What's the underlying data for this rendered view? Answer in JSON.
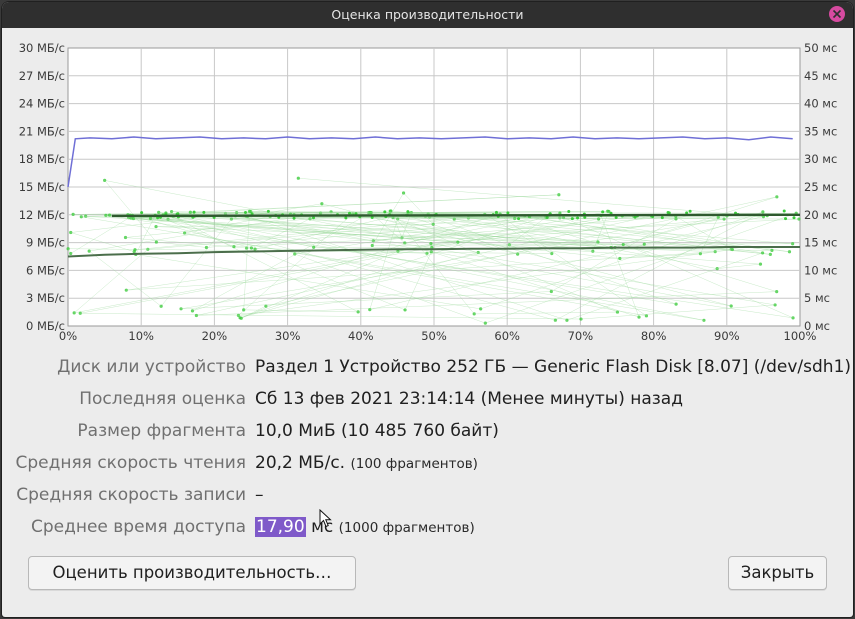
{
  "window": {
    "title": "Оценка производительности"
  },
  "chart": {
    "left_axis_ticks": [
      "30 МБ/с",
      "27 МБ/с",
      "24 МБ/с",
      "21 МБ/с",
      "18 МБ/с",
      "15 МБ/с",
      "12 МБ/с",
      "9 МБ/с",
      "6 МБ/с",
      "3 МБ/с",
      "0 МБ/с"
    ],
    "right_axis_ticks": [
      "50 мс",
      "45 мс",
      "40 мс",
      "35 мс",
      "30 мс",
      "25 мс",
      "20 мс",
      "15 мс",
      "10 мс",
      "5 мс",
      "0 мс"
    ],
    "x_axis_ticks": [
      "0%",
      "10%",
      "20%",
      "30%",
      "40%",
      "50%",
      "60%",
      "70%",
      "80%",
      "90%",
      "100%"
    ],
    "colors": {
      "read_rate": "#6f6fd6",
      "access_time": "#3ccc3c",
      "grid": "#c8c8c8",
      "plot_bg": "#ffffff"
    }
  },
  "chart_data": {
    "type": "line",
    "y_left_range": [
      0,
      30
    ],
    "y_right_range": [
      0,
      50
    ],
    "x_range": [
      0,
      100
    ],
    "series": [
      {
        "axis": "left",
        "x": [
          0,
          1,
          3,
          6,
          9,
          12,
          15,
          18,
          21,
          24,
          27,
          30,
          33,
          36,
          39,
          42,
          45,
          48,
          51,
          54,
          57,
          60,
          63,
          66,
          69,
          72,
          75,
          78,
          81,
          84,
          87,
          90,
          93,
          96,
          99
        ],
        "values": [
          15.0,
          20.2,
          20.3,
          20.2,
          20.4,
          20.2,
          20.3,
          20.4,
          20.2,
          20.3,
          20.2,
          20.4,
          20.2,
          20.3,
          20.2,
          20.4,
          20.2,
          20.3,
          20.2,
          20.3,
          20.4,
          20.2,
          20.3,
          20.2,
          20.4,
          20.2,
          20.3,
          20.2,
          20.3,
          20.4,
          20.2,
          20.3,
          20.1,
          20.4,
          20.2
        ]
      },
      {
        "axis": "right",
        "x": [
          0,
          5,
          10,
          15,
          20,
          25,
          30,
          35,
          40,
          45,
          50,
          55,
          60,
          65,
          70,
          75,
          80,
          85,
          90,
          95,
          100
        ],
        "values": [
          12.5,
          12.8,
          13.0,
          13.1,
          13.3,
          13.4,
          13.5,
          13.6,
          13.7,
          13.8,
          13.8,
          13.9,
          13.9,
          14.0,
          14.0,
          14.1,
          14.1,
          14.1,
          14.2,
          14.2,
          14.2
        ]
      },
      {
        "axis": "right",
        "x": [
          6,
          100
        ],
        "values": [
          19.8,
          20.0
        ]
      }
    ]
  },
  "info": {
    "device_label": "Диск или устройство",
    "device_value": "Раздел 1 Устройство 252 ГБ — Generic Flash Disk [8.07] (/dev/sdh1)",
    "last_label": "Последняя оценка",
    "last_value": "Сб 13 фев 2021 23:14:14 (Менее минуты) назад",
    "chunk_label": "Размер фрагмента",
    "chunk_value": "10,0 МиБ (10 485 760 байт)",
    "read_label": "Средняя скорость чтения",
    "read_value": "20,2 МБ/с.",
    "read_note": "(100 фрагментов)",
    "write_label": "Средняя скорость записи",
    "write_value": "–",
    "access_label": "Среднее время доступа",
    "access_value": "17,90",
    "access_unit": " мс",
    "access_note": "(1000 фрагментов)"
  },
  "buttons": {
    "benchmark": "Оценить производительность…",
    "close": "Закрыть"
  }
}
